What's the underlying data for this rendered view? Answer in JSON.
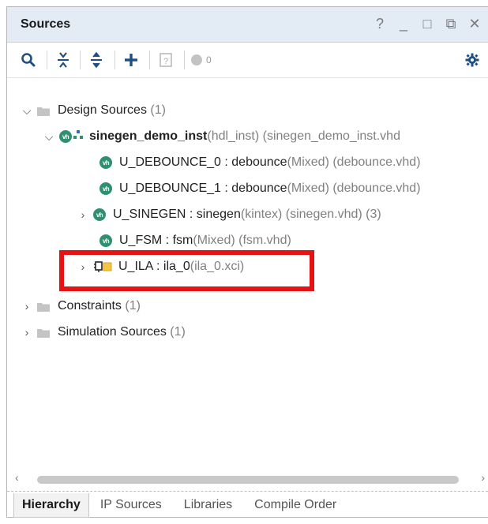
{
  "panel": {
    "title": "Sources",
    "window_buttons": [
      "?",
      "_",
      "□",
      "⧉",
      "✕"
    ]
  },
  "toolbar": {
    "search_icon": "search-icon",
    "collapse_all_icon": "collapse-all-icon",
    "expand_all_icon": "expand-all-icon",
    "add_icon": "plus-icon",
    "help_icon": "question-icon",
    "status_count": "0",
    "settings_icon": "gear-icon"
  },
  "tree": {
    "design_sources": {
      "label": "Design Sources",
      "count": "(1)"
    },
    "top_inst": {
      "name": "sinegen_demo_inst",
      "detail": "(hdl_inst) (sinegen_demo_inst.vhd"
    },
    "debounce0": {
      "name": "U_DEBOUNCE_0 : debounce",
      "detail": "(Mixed) (debounce.vhd)"
    },
    "debounce1": {
      "name": "U_DEBOUNCE_1 : debounce",
      "detail": "(Mixed) (debounce.vhd)"
    },
    "sinegen": {
      "name": "U_SINEGEN : sinegen",
      "detail": "(kintex) (sinegen.vhd) (3)"
    },
    "fsm": {
      "name": "U_FSM : fsm",
      "detail": "(Mixed) (fsm.vhd)"
    },
    "ila": {
      "name": "U_ILA : ila_0",
      "detail": " (ila_0.xci)"
    },
    "constraints": {
      "label": "Constraints",
      "count": "(1)"
    },
    "simulation": {
      "label": "Simulation Sources",
      "count": "(1)"
    }
  },
  "tabs": [
    "Hierarchy",
    "IP Sources",
    "Libraries",
    "Compile Order"
  ],
  "colors": {
    "header_bg": "#e3ebf5",
    "highlight": "#e41414",
    "vhd_icon": "#2f8f6e"
  }
}
